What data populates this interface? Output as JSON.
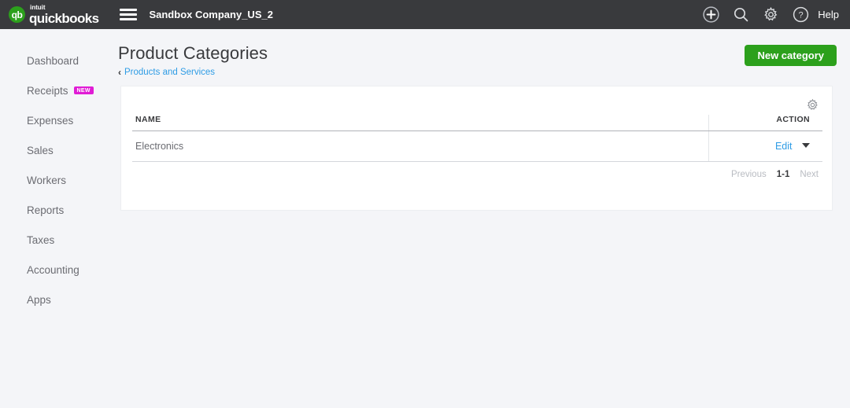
{
  "topbar": {
    "logo": {
      "mark_text": "qb",
      "brand_small": "intuit",
      "brand_main": "quickbooks"
    },
    "menu_icon": "hamburger-menu-icon",
    "company_name": "Sandbox Company_US_2",
    "icons": [
      {
        "name": "add-icon",
        "label": "plus-circle-icon"
      },
      {
        "name": "search-icon",
        "label": "magnifier-icon"
      },
      {
        "name": "settings-icon",
        "label": "gear-icon"
      },
      {
        "name": "help-icon",
        "label": "question-circle-icon"
      }
    ],
    "help_label": "Help",
    "background": "#393a3d",
    "accent_green": "#2ca01c"
  },
  "sidebar": {
    "items": [
      {
        "label": "Dashboard",
        "badge": ""
      },
      {
        "label": "Receipts",
        "badge": "NEW"
      },
      {
        "label": "Expenses",
        "badge": ""
      },
      {
        "label": "Sales",
        "badge": ""
      },
      {
        "label": "Workers",
        "badge": ""
      },
      {
        "label": "Reports",
        "badge": ""
      },
      {
        "label": "Taxes",
        "badge": ""
      },
      {
        "label": "Accounting",
        "badge": ""
      },
      {
        "label": "Apps",
        "badge": ""
      }
    ],
    "badge_color": "#e01cd5"
  },
  "page": {
    "title": "Product Categories",
    "breadcrumb_chevron": "‹",
    "breadcrumb_label": "Products and Services",
    "breadcrumb_color": "#2e9ce5",
    "primary_button": "New category",
    "primary_button_color": "#2ca01c"
  },
  "table": {
    "settings_icon": "gear-icon",
    "columns": [
      "NAME",
      "ACTION"
    ],
    "rows": [
      {
        "name": "Electronics",
        "action": "Edit"
      }
    ],
    "link_color": "#2e9ce5"
  },
  "pagination": {
    "previous": "Previous",
    "range": "1-1",
    "next": "Next"
  }
}
